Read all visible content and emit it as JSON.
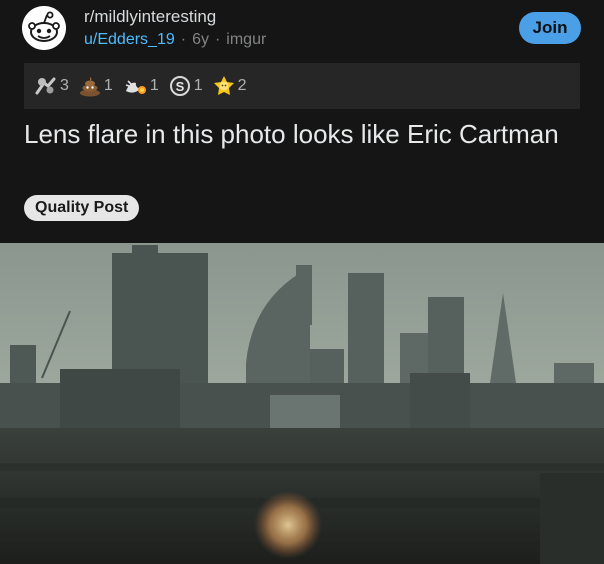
{
  "post": {
    "subreddit": "r/mildlyinteresting",
    "author": "u/Edders_19",
    "age": "6y",
    "source": "imgur",
    "separator": "·",
    "join_label": "Join",
    "title": "Lens flare in this photo looks like Eric Cartman",
    "flair": "Quality Post"
  },
  "awards": [
    {
      "icon": "silver-award-icon",
      "count": "3"
    },
    {
      "icon": "poop-award-icon",
      "count": "1"
    },
    {
      "icon": "rocket-like-award-icon",
      "count": "1"
    },
    {
      "icon": "coin-award-icon",
      "count": "1"
    },
    {
      "icon": "wholesome-award-icon",
      "count": "2"
    }
  ],
  "colors": {
    "background": "#151515",
    "award_bar": "#262626",
    "join_button": "#4b9fe6",
    "username": "#4fbcff",
    "flair_bg": "#e6e6e6"
  }
}
